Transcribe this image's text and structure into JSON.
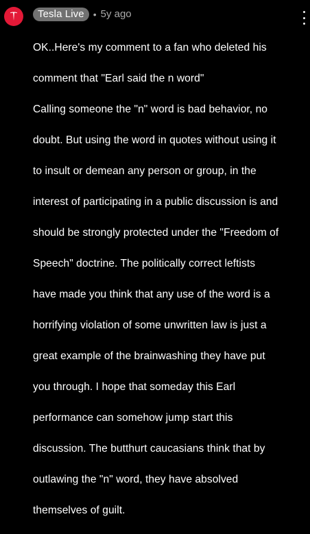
{
  "comment": {
    "author": "Tesla Live",
    "separator": "•",
    "timestamp": "5y ago",
    "avatar_icon": "tesla-logo-icon",
    "avatar_color": "#e31937",
    "chip_color": "#717171",
    "menu_icon": "more-vert-icon",
    "lines": [
      "OK..Here's my comment to a fan who deleted his",
      "comment that \"Earl said the n word\"",
      "Calling someone the \"n\" word is bad behavior, no",
      "doubt.  But using the word in quotes without using it",
      "to insult or demean any person or group, in the",
      "interest of participating in a public discussion is and",
      "should be strongly protected under the \"Freedom of",
      "Speech\" doctrine. The politically correct leftists",
      "have made you think that any use of the word is a",
      "horrifying violation of some unwritten law is just a",
      "great example of the brainwashing they have put",
      "you through. I hope that someday this Earl",
      "performance can somehow jump start this",
      "discussion. The butthurt caucasians  think that by",
      "outlawing the \"n\" word, they have absolved",
      "themselves of guilt."
    ]
  }
}
